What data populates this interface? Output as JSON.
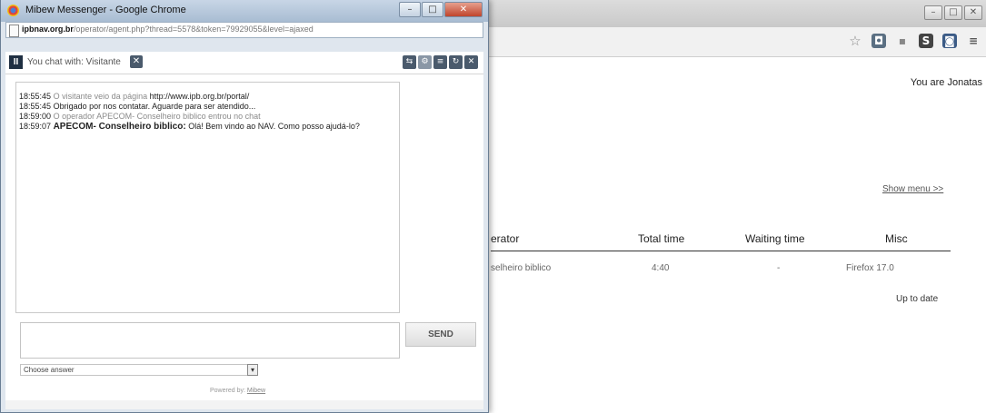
{
  "popup": {
    "window_title": "Mibew Messenger - Google Chrome",
    "address_bar": {
      "domain": "ipbnav.org.br",
      "path": "/operator/agent.php?thread=5578&token=79929055&level=ajaxed"
    },
    "window_controls": {
      "minimize": "–",
      "maximize": "□",
      "close": "✕"
    }
  },
  "chat_header": {
    "logo_text": "II",
    "title": "You chat with: Visitante",
    "close_x": "✕",
    "tools": [
      "⇆",
      "⚙",
      "≡",
      "↻",
      "✕"
    ]
  },
  "messages": [
    {
      "time": "18:55:45",
      "text": "O visitante veio da página",
      "link": "http://www.ipb.org.br/portal/",
      "style": "system"
    },
    {
      "time": "18:55:45",
      "text": "Obrigado por nos contatar. Aguarde para ser atendido...",
      "style": "info"
    },
    {
      "time": "18:59:00",
      "text": "O operador APECOM- Conselheiro biblico entrou no chat",
      "style": "system"
    },
    {
      "time": "18:59:07",
      "author": "APECOM- Conselheiro biblico",
      "text": "Olá! Bem vindo ao NAV.  Como posso ajudá-lo?",
      "style": "operator"
    }
  ],
  "composer": {
    "send_label": "SEND",
    "answer_placeholder": "Choose answer",
    "powered_prefix": "Powered by:",
    "powered_link": "Mibew"
  },
  "background_page": {
    "user_label": "You are Jonatas",
    "show_menu": "Show menu >>",
    "columns": [
      "erator",
      "Total time",
      "Waiting time",
      "Misc"
    ],
    "row": [
      "selheiro biblico",
      "4:40",
      "-",
      "Firefox 17.0"
    ],
    "status": "Up to date",
    "window_controls": {
      "minimize": "–",
      "maximize": "□",
      "close": "✕"
    }
  }
}
